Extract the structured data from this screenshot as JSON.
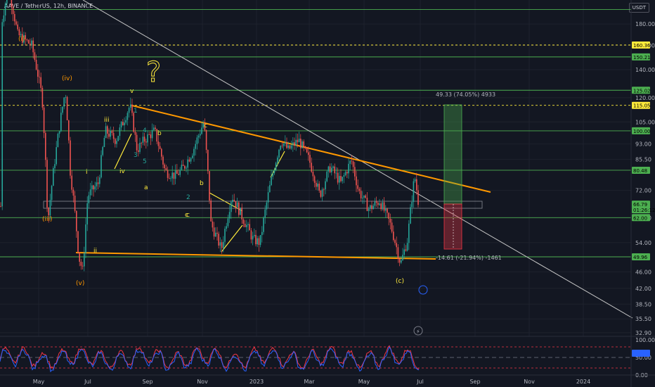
{
  "header": {
    "symbol_line": "AAVE / TetherUS, 12h, BINANCE",
    "currency_button": "USDT"
  },
  "chart_data": {
    "type": "candlestick",
    "symbol": "AAVE / TetherUS",
    "interval": "12h",
    "exchange": "BINANCE",
    "y_scale": "log",
    "ylim": [
      31,
      230
    ],
    "x_ticks": [
      "May",
      "Jul",
      "Sep",
      "Nov",
      "2023",
      "Mar",
      "May",
      "Jul",
      "Sep",
      "Nov",
      "2024"
    ],
    "y_ticks": [
      180.0,
      160.0,
      140.0,
      120.0,
      105.0,
      93.0,
      85.5,
      72.0,
      62.0,
      54.0,
      46.0,
      42.0,
      38.5,
      35.5,
      32.9
    ],
    "price_labels": [
      {
        "value": "160.36",
        "color": "#ffeb3b"
      },
      {
        "value": "150.21",
        "color": "#4caf50"
      },
      {
        "value": "125.02",
        "color": "#4caf50"
      },
      {
        "value": "115.05",
        "color": "#ffeb3b"
      },
      {
        "value": "100.00",
        "color": "#4caf50"
      },
      {
        "value": "80.48",
        "color": "#4caf50"
      },
      {
        "value": "66.79",
        "color": "#4caf50",
        "sub": "01:26:12"
      },
      {
        "value": "62.00",
        "color": "#4caf50"
      },
      {
        "value": "49.96",
        "color": "#4caf50"
      }
    ],
    "horizontal_levels": [
      195,
      150.21,
      125.02,
      100.0,
      80.48,
      62.0,
      49.96
    ],
    "dotted_levels": [
      160.36,
      115.05
    ],
    "long_position": {
      "target_text": "49.33 (74.05%) 4933",
      "stop_text": "-14.61 (-21.94%) -1461"
    },
    "wave_labels": [
      "(i)",
      "(iv)",
      "(iii)",
      "(v)",
      "i",
      "ii",
      "iii",
      "iv",
      "v",
      "a",
      "b",
      "c",
      "b",
      "c",
      "c",
      "(c)",
      "1",
      "2",
      "3",
      "4",
      "5"
    ],
    "oscillator": {
      "ticks": [
        "100.00",
        "50.00",
        "0.00"
      ],
      "current": 62
    }
  }
}
